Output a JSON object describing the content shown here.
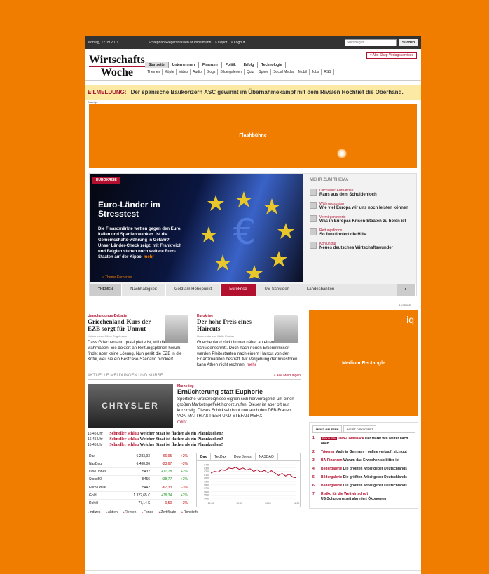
{
  "topbar": {
    "date": "Montag, 12.09.2011",
    "links": [
      "» Stephan Wegershausen Mumpelmann",
      "» Depot",
      "» Logout"
    ],
    "search_placeholder": "Suchbegriff",
    "search_button": "Suchen"
  },
  "header": {
    "logo_line1": "Wirtschafts",
    "logo_line2": "Woche",
    "abo_links": [
      "Abo",
      "Shop",
      "Verlagsservices"
    ],
    "nav_primary": [
      "Startseite",
      "Unternehmen",
      "Finanzen",
      "Politik",
      "Erfolg",
      "Technologie"
    ],
    "nav_secondary": [
      "Themen",
      "Köpfe",
      "Video",
      "Audio",
      "Blogs",
      "Bildergalerien",
      "Quiz",
      "Spiele",
      "Social Media",
      "Mobil",
      "Jobs",
      "RSS"
    ]
  },
  "breaking": {
    "label": "EILMELDUNG:",
    "text": "Der spanische Baukonzern ASC gewinnt im Übernahmekampf mit dem Rivalen Hochtief die Oberhand."
  },
  "ad_label": "Anzeige",
  "flash_label": "Flashbühne",
  "teaser": {
    "category": "EUROKRISE",
    "title": "Euro-Länder im Stresstest",
    "text": "Die Finanzmärkte wetten gegen den Euro, Italien und Spanien wanken. Ist die Gemeinschafts-währung in Gefahr? Unser Länder-Check zeigt: mit Frankreich und Belgien stehen noch weitere Euro-Staaten auf der Kippe.",
    "mehr": "mehr",
    "more_link": "» Thema Eurokrise",
    "sidebar_title": "MEHR ZUM THEMA",
    "sidebar_items": [
      {
        "kicker": "Dachzeile: Euro-Krise",
        "title": "Raus aus dem Schuldenloch"
      },
      {
        "kicker": "Währungsunion",
        "title": "Wie viel Europa wir uns noch leisten können"
      },
      {
        "kicker": "Vermögenswerte",
        "title": "Was in Europas Krisen-Staaten zu holen ist"
      },
      {
        "kicker": "Rettungsfonds",
        "title": "So funktioniert die Hilfe"
      },
      {
        "kicker": "Konjunktur",
        "title": "Neues deutsches Wirtschaftswunder"
      }
    ]
  },
  "themen": {
    "head": "THEMEN",
    "items": [
      "Nachhaltigkeit",
      "Gold am Höhepunkt",
      "Eurokrise",
      "US-Schulden",
      "Landesbanken"
    ]
  },
  "ad_label2": "ANZEIGE",
  "kolumnen": [
    {
      "kicker": "Umschuldungs-Debatte",
      "title": "Griechenland-Kurs der EZB sorgt für Unmut",
      "byline": "Kolumne von Oliver Engelmann",
      "text": "Dass Griechenland quasi pleite ist, will die EU nicht wahrhaben. Sie doktert an Rettungsplänen herum, findet aber keine Lösung. Nun gerät die EZB in die Kritik, weil sie ein Bestcase-Szenario blockiert."
    },
    {
      "kicker": "Eurokrise",
      "title": "Der hohe Preis eines Haircuts",
      "byline": "Kommentar von Malte Fischer",
      "text": "Griechenland rückt immer näher an einen Schuldenschnitt. Doch nach neuen Erkenntnissen werden Pleitestaaten nach einem Haircut von den Finanzmärkten bestraft. Mit Vergebung der Investoren kann Athen nicht rechnen.",
      "mehr": "mehr"
    }
  ],
  "aktuell": {
    "title": "AKTUELLE MELDUNGEN UND KURSE",
    "all_link": "» Alle Meldungen",
    "story": {
      "image_text": "CHRYSLER",
      "kicker": "Marketing",
      "title": "Ernüchterung statt Euphorie",
      "text": "Sportliche Großereignisse eignen sich hervorragend, um einen großen Marketingeffekt honorzurufen. Dieser ist aber oft nur kurzfristig. Dieses Schicksal droht nun auch den DFB-Frauen. VON MATTHIAS PEER UND STEFAN MERX",
      "mehr": "mehr"
    },
    "ticker": [
      {
        "time": "16:45 Uhr",
        "kicker": "Schneller schlau",
        "title": "Welcher Staat ist flacher als ein Pfannkuchen?"
      },
      {
        "time": "16:45 Uhr",
        "kicker": "Schneller schlau",
        "title": "Welcher Staat ist flacher als ein Pfannkuchen?"
      },
      {
        "time": "16:45 Uhr",
        "kicker": "Schneller schlau",
        "title": "Welcher Staat ist flacher als ein Pfannkuchen?"
      }
    ]
  },
  "markets": {
    "rows": [
      {
        "name": "Dax",
        "value": "6.283,93",
        "change": "-66,95",
        "pct": "+2%",
        "dir": "neg"
      },
      {
        "name": "NasDaq",
        "value": "6.488,06",
        "change": "-23,67",
        "pct": "-3%",
        "dir": "neg"
      },
      {
        "name": "Dow Jones",
        "value": "5432",
        "change": "+11,78",
        "pct": "+2%",
        "dir": "pos"
      },
      {
        "name": "Stoxx50",
        "value": "5456",
        "change": "+38,77",
        "pct": "+2%",
        "dir": "pos"
      },
      {
        "name": "Euro/Dollar",
        "value": "5442",
        "change": "-67,33",
        "pct": "-3%",
        "dir": "neg"
      },
      {
        "name": "Gold",
        "value": "1.322,65 €",
        "change": "+78,34",
        "pct": "+2%",
        "dir": "pos"
      },
      {
        "name": "Rohöl",
        "value": "77,14 $",
        "change": "-0,50",
        "pct": "-3%",
        "dir": "neg"
      }
    ],
    "tabs": [
      "Dax",
      "TecDax",
      "Dow Jones",
      "NASDAQ"
    ],
    "links": [
      "Indizes",
      "Aktien",
      "Renten",
      "Fonds",
      "Zertifikate",
      "Rohstoffe"
    ]
  },
  "chart_data": {
    "type": "line",
    "title": "Dax",
    "x": [
      "10:00",
      "",
      "",
      "",
      "",
      "",
      "",
      "",
      "12:00",
      "",
      "",
      "",
      "",
      "",
      "",
      "",
      "14:00",
      "",
      "",
      "",
      "",
      "",
      "",
      "",
      "16:00"
    ],
    "y_ticks": [
      "6400",
      "6300",
      "6200",
      "6100",
      "6000",
      "5900",
      "5800",
      "5700",
      "5600",
      "5500",
      "5400"
    ],
    "x_ticks": [
      "10:00",
      "12:00",
      "14:00",
      "16:00"
    ],
    "ylim": [
      5400,
      6400
    ],
    "series": [
      {
        "values": [
          6150,
          6200,
          6180,
          6250,
          6230,
          6300,
          6280,
          6320,
          6260,
          6300,
          6240,
          6280,
          6200,
          6250,
          6180,
          6230,
          6160,
          6220,
          6150,
          6080,
          6140,
          6060,
          6120,
          6030,
          6010
        ]
      }
    ]
  },
  "right": {
    "ad_label": "Medium Rectangle",
    "iq": "iq",
    "tabs": [
      "MEIST GELESEN",
      "MEIST DISKUTIERT"
    ],
    "items": [
      {
        "num": "1.",
        "exklusiv": "EXKLUSIV",
        "kicker": "Dax-Comeback",
        "title": "Der Markt will weiter nach oben"
      },
      {
        "num": "2.",
        "kicker": "Trigema",
        "title": "Made in Germany - online verkauft sich gut"
      },
      {
        "num": "3.",
        "kicker": "BA-Finanzen",
        "title": "Warum das Erwachen so bitter ist"
      },
      {
        "num": "4.",
        "kicker": "Bildergalerie",
        "title": "Die größten Arbeitgeber Deutschlands"
      },
      {
        "num": "5.",
        "kicker": "Bildergalerie",
        "title": "Die größten Arbeitgeber Deutschlands"
      },
      {
        "num": "6.",
        "kicker": "Bildergalerie",
        "title": "Die größten Arbeitgeber Deutschlands"
      },
      {
        "num": "7.",
        "kicker": "Risiko für die Weltwirtschaft",
        "title": "US-Schuldenstreit alarmiert Ökonomen"
      }
    ]
  },
  "colors": {
    "brand_red": "#b2102f",
    "accent_orange": "#f07d00",
    "breaking_bg": "#fbe9a4"
  }
}
